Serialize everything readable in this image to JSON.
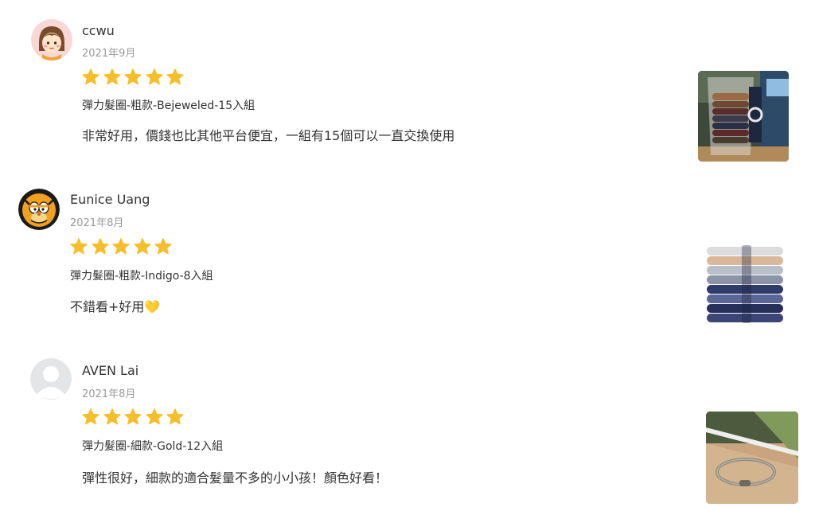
{
  "reviews": [
    {
      "name": "ccwu",
      "date": "2021年9月",
      "rating": 5,
      "variant": "彈力髮圈-粗款-Bejeweled-15入組",
      "comment": "非常好用，價錢也比其他平台便宜，一組有15個可以一直交換使用",
      "avatar": "girl-avatar",
      "photo": "cup-with-hair-ties"
    },
    {
      "name": "Eunice Uang",
      "date": "2021年8月",
      "rating": 5,
      "variant": "彈力髮圈-粗款-Indigo-8入組",
      "comment": "不錯看+好用💛",
      "avatar": "cartoon-cat-avatar",
      "photo": "stacked-hair-ties"
    },
    {
      "name": "AVEN Lai",
      "date": "2021年8月",
      "rating": 5,
      "variant": "彈力髮圈-細款-Gold-12入組",
      "comment": "彈性很好，細款的適合髮量不多的小小孩！顏色好看！",
      "avatar": "default-user-avatar",
      "photo": "hair-tie-on-windowsill"
    }
  ],
  "colors": {
    "star": "#F7BE2C",
    "date": "#9A9A9A",
    "text": "#333333"
  }
}
